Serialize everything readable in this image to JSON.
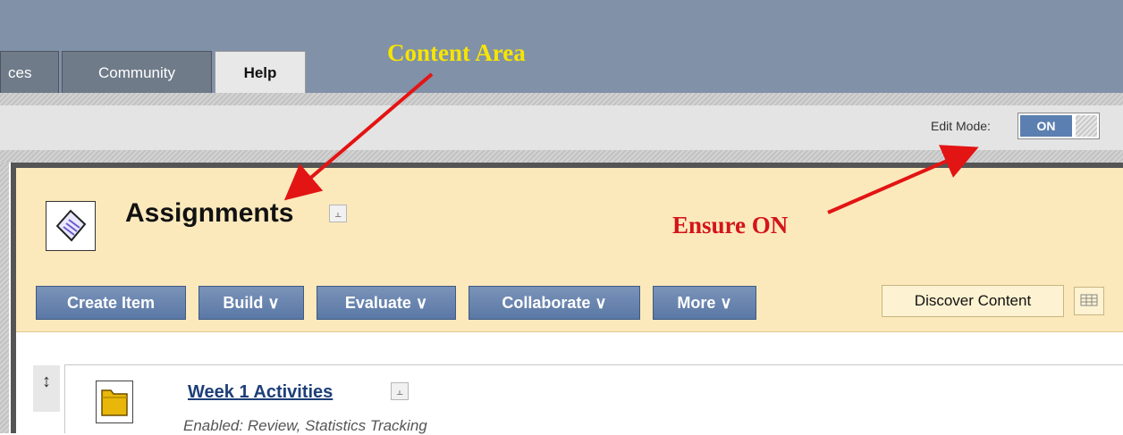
{
  "tabs": [
    {
      "label": "ces"
    },
    {
      "label": "Community"
    },
    {
      "label": "Help"
    }
  ],
  "edit_mode": {
    "label": "Edit Mode:",
    "state": "ON"
  },
  "content_area": {
    "title": "Assignments",
    "toolbar": {
      "create_item": "Create Item",
      "build": "Build",
      "evaluate": "Evaluate",
      "collaborate": "Collaborate",
      "more": "More",
      "discover": "Discover Content"
    },
    "items": [
      {
        "title": "Week 1 Activities",
        "meta": "Enabled: Review, Statistics Tracking"
      }
    ]
  },
  "annotations": {
    "content_area": "Content Area",
    "ensure_on": "Ensure ON"
  },
  "colors": {
    "annotation_yellow": "#f6e500",
    "annotation_red": "#d4141a",
    "toolbar_blue": "#5a78a6",
    "header_bg": "#fbe9bc"
  }
}
